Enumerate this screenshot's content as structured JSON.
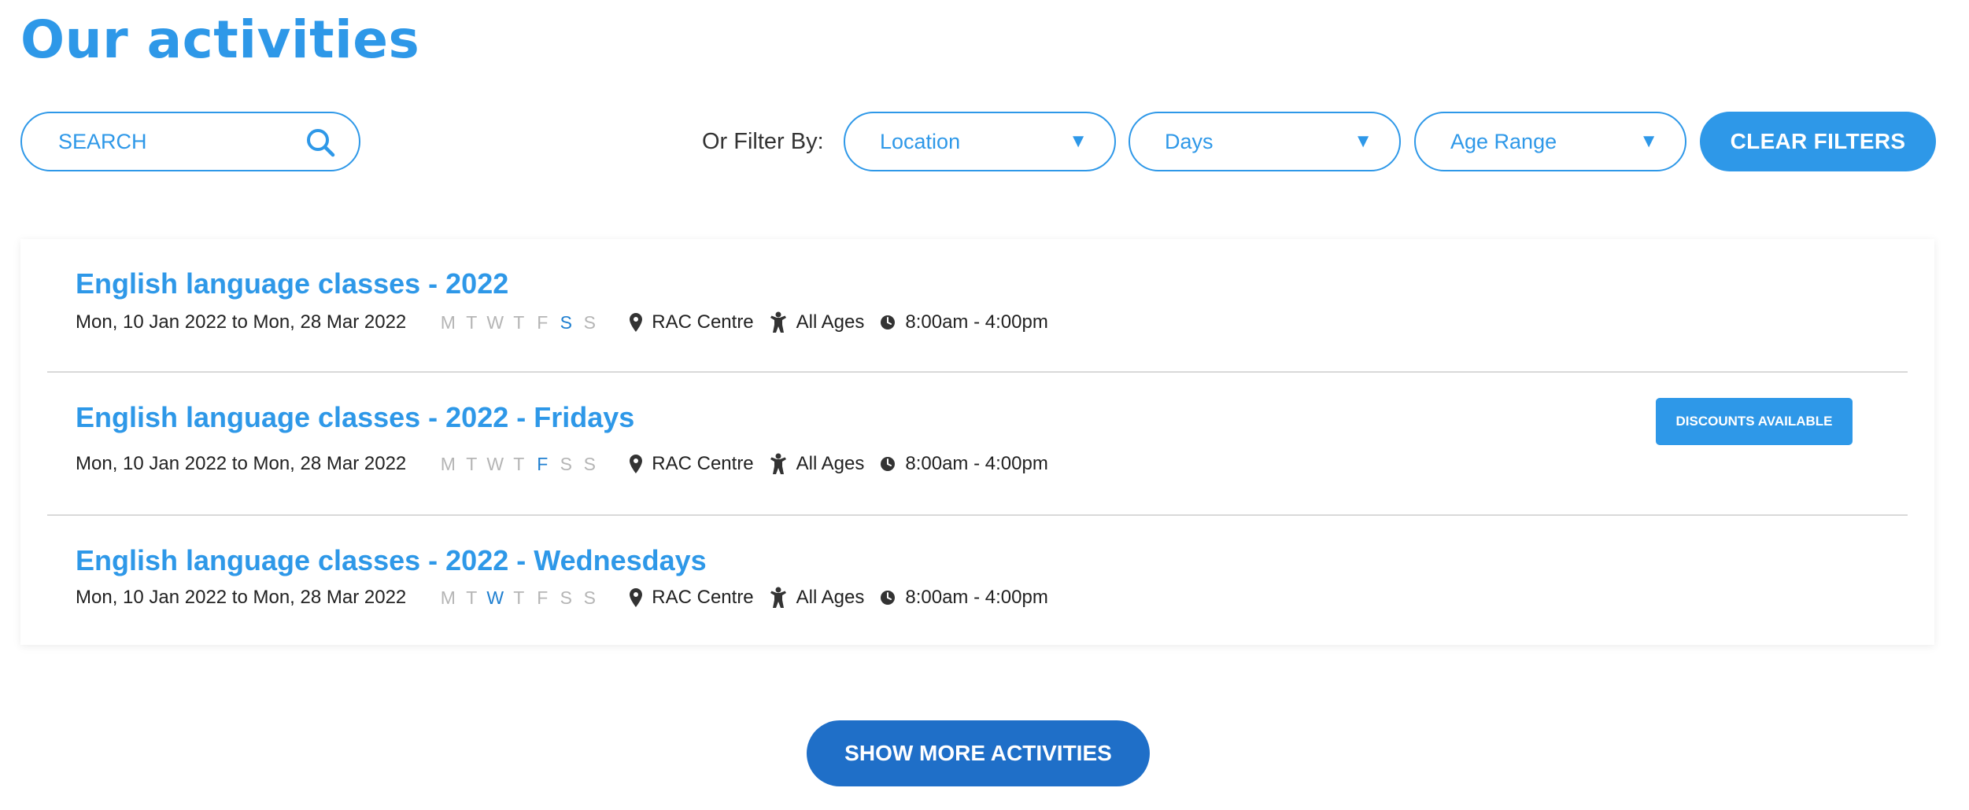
{
  "page_title": "Our activities",
  "search": {
    "placeholder": "SEARCH",
    "icon": "search-icon"
  },
  "filters": {
    "label": "Or Filter By:",
    "location": "Location",
    "days": "Days",
    "age_range": "Age Range",
    "caret": "▼",
    "clear_label": "CLEAR FILTERS"
  },
  "weekday_letters": [
    "M",
    "T",
    "W",
    "T",
    "F",
    "S",
    "S"
  ],
  "activities": [
    {
      "title": "English language classes - 2022",
      "dates": "Mon, 10 Jan 2022 to Mon, 28 Mar 2022",
      "active_days": [
        false,
        false,
        false,
        false,
        false,
        true,
        false
      ],
      "location": "RAC Centre",
      "ages": "All Ages",
      "time": "8:00am - 4:00pm"
    },
    {
      "title": "English language classes - 2022 - Fridays",
      "dates": "Mon, 10 Jan 2022 to Mon, 28 Mar 2022",
      "active_days": [
        false,
        false,
        false,
        false,
        true,
        false,
        false
      ],
      "location": "RAC Centre",
      "ages": "All Ages",
      "time": "8:00am - 4:00pm",
      "badge": "DISCOUNTS AVAILABLE"
    },
    {
      "title": "English language classes - 2022 - Wednesdays",
      "dates": "Mon, 10 Jan 2022 to Mon, 28 Mar 2022",
      "active_days": [
        false,
        false,
        true,
        false,
        false,
        false,
        false
      ],
      "location": "RAC Centre",
      "ages": "All Ages",
      "time": "8:00am - 4:00pm"
    }
  ],
  "show_more_label": "SHOW MORE ACTIVITIES",
  "colors": {
    "accent": "#2e98e8",
    "button_dark": "#1f6fc8",
    "inactive_day": "#b5b5b5"
  }
}
